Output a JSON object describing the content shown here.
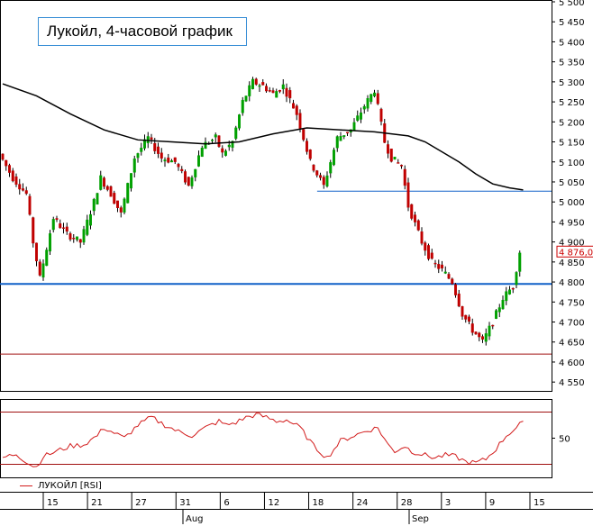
{
  "title": "Лукойл, 4-часовой график",
  "colors": {
    "up": "#00a000",
    "down": "#c00000",
    "ma": "#000000",
    "support": "#1060c8",
    "resistance_red": "#a01010",
    "rsi": "#d21a1a",
    "price_tag": "#cc0000"
  },
  "chart_data": [
    {
      "type": "candlestick",
      "ylim": [
        4520,
        5500
      ],
      "y_ticks": [
        4550,
        4600,
        4650,
        4700,
        4750,
        4800,
        4850,
        4900,
        4950,
        5000,
        5050,
        5100,
        5150,
        5200,
        5250,
        5300,
        5350,
        5400,
        5450,
        5500
      ],
      "y_tick_labels": [
        "4 550",
        "4 600",
        "4 650",
        "4 700",
        "4 750",
        "4 800",
        "4 850",
        "4 900",
        "4 950",
        "5 000",
        "5 050",
        "5 100",
        "5 150",
        "5 200",
        "5 250",
        "5 300",
        "5 350",
        "5 400",
        "5 450",
        "5 500"
      ],
      "last_price": 4876.0,
      "last_price_label": "4 876,0",
      "x_labels": [
        "15",
        "21",
        "27",
        "31",
        "6",
        "12",
        "18",
        "24",
        "28",
        "3",
        "9",
        "15"
      ],
      "months": [
        "Aug",
        "Sep"
      ],
      "series": [
        {
          "kind": "close_path",
          "x": [
            0,
            4,
            8,
            10,
            12,
            16,
            20,
            24,
            28,
            30,
            33,
            36,
            40,
            44,
            48,
            52,
            56,
            60,
            64,
            66,
            69,
            72,
            75,
            78,
            81,
            84,
            88,
            92,
            96,
            100,
            104,
            108,
            111,
            114,
            116,
            119,
            121,
            125,
            128,
            131,
            134,
            137,
            140,
            143
          ],
          "values": [
            5120,
            5060,
            5020,
            4900,
            4810,
            4960,
            4920,
            4900,
            5000,
            5060,
            5020,
            4970,
            5110,
            5160,
            5110,
            5100,
            5040,
            5140,
            5160,
            5120,
            5150,
            5250,
            5300,
            5290,
            5270,
            5290,
            5220,
            5100,
            5040,
            5160,
            5180,
            5240,
            5280,
            5150,
            5110,
            5090,
            4990,
            4900,
            4850,
            4830,
            4800,
            4720,
            4680,
            4650
          ]
        },
        {
          "kind": "close_path_tail",
          "x": [
            143,
            146,
            149,
            152,
            154
          ],
          "values": [
            4650,
            4700,
            4760,
            4790,
            4876
          ]
        }
      ],
      "moving_average": {
        "x": [
          0,
          10,
          20,
          30,
          40,
          50,
          60,
          70,
          80,
          90,
          100,
          110,
          120,
          125,
          130,
          135,
          140,
          145,
          150,
          154
        ],
        "values": [
          5295,
          5265,
          5220,
          5180,
          5155,
          5150,
          5145,
          5150,
          5170,
          5185,
          5180,
          5175,
          5165,
          5150,
          5125,
          5100,
          5070,
          5045,
          5035,
          5030
        ]
      },
      "horizontal_lines": [
        {
          "value": 4795,
          "color": "support",
          "from": 0,
          "to": 1
        },
        {
          "value": 5027,
          "color": "support",
          "from": 0.575,
          "to": 1
        },
        {
          "value": 4620,
          "color": "resistance_red",
          "from": 0,
          "to": 1
        }
      ]
    },
    {
      "type": "line",
      "legend": "ЛУКОЙЛ [RSI]",
      "ylim": [
        20,
        80
      ],
      "y_ticks": [
        50
      ],
      "y_tick_labels": [
        "50"
      ],
      "levels": [
        30,
        70
      ],
      "x": [
        0,
        4,
        8,
        10,
        12,
        16,
        20,
        24,
        28,
        30,
        33,
        36,
        40,
        44,
        48,
        52,
        56,
        60,
        64,
        66,
        69,
        72,
        75,
        78,
        81,
        84,
        88,
        92,
        96,
        100,
        104,
        108,
        111,
        114,
        116,
        119,
        121,
        125,
        128,
        131,
        134,
        137,
        140,
        143,
        146,
        149,
        152,
        154
      ],
      "values": [
        35,
        38,
        30,
        28,
        36,
        40,
        44,
        45,
        52,
        58,
        54,
        50,
        60,
        66,
        60,
        55,
        52,
        58,
        63,
        60,
        62,
        66,
        68,
        66,
        63,
        64,
        58,
        44,
        35,
        48,
        52,
        56,
        58,
        45,
        40,
        44,
        40,
        37,
        35,
        37,
        36,
        32,
        31,
        34,
        42,
        52,
        58,
        63
      ]
    }
  ]
}
